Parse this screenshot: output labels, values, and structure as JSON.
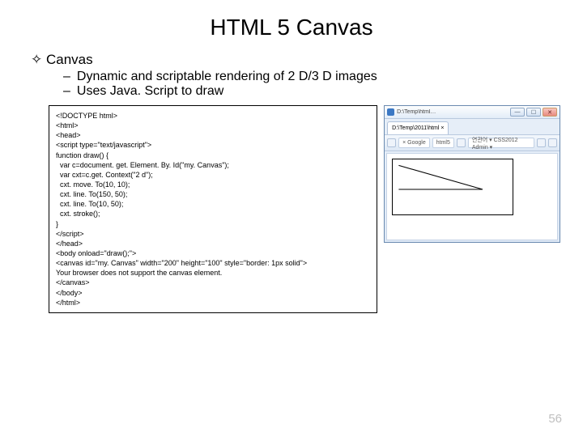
{
  "title": "HTML 5 Canvas",
  "section": {
    "bullet": "✧",
    "label": "Canvas"
  },
  "subs": [
    "Dynamic and scriptable rendering of 2 D/3 D images",
    "Uses Java. Script to draw"
  ],
  "code": "<!DOCTYPE html>\n<html>\n<head>\n<script type=\"text/javascript\">\nfunction draw() {\n  var c=document. get. Element. By. Id(\"my. Canvas\");\n  var cxt=c.get. Context(\"2 d\");\n  cxt. move. To(10, 10);\n  cxt. line. To(150, 50);\n  cxt. line. To(10, 50);\n  cxt. stroke();\n}\n</script>\n</head>\n<body onload=\"draw();\">\n<canvas id=\"my. Canvas\" width=\"200\" height=\"100\" style=\"border: 1px solid\">\nYour browser does not support the canvas element.\n</canvas>\n</body>\n</html>",
  "browser": {
    "titlePath": "D:\\Temp\\html…",
    "tabLabel": "D:\\Temp\\2011\\html ×",
    "toolbar": {
      "left": "× Google",
      "mid": "html5",
      "right": "연관어 ▾ CSS2012 Admin ▾"
    },
    "winMin": "—",
    "winMax": "☐",
    "winClose": "✕"
  },
  "pageNum": "56"
}
